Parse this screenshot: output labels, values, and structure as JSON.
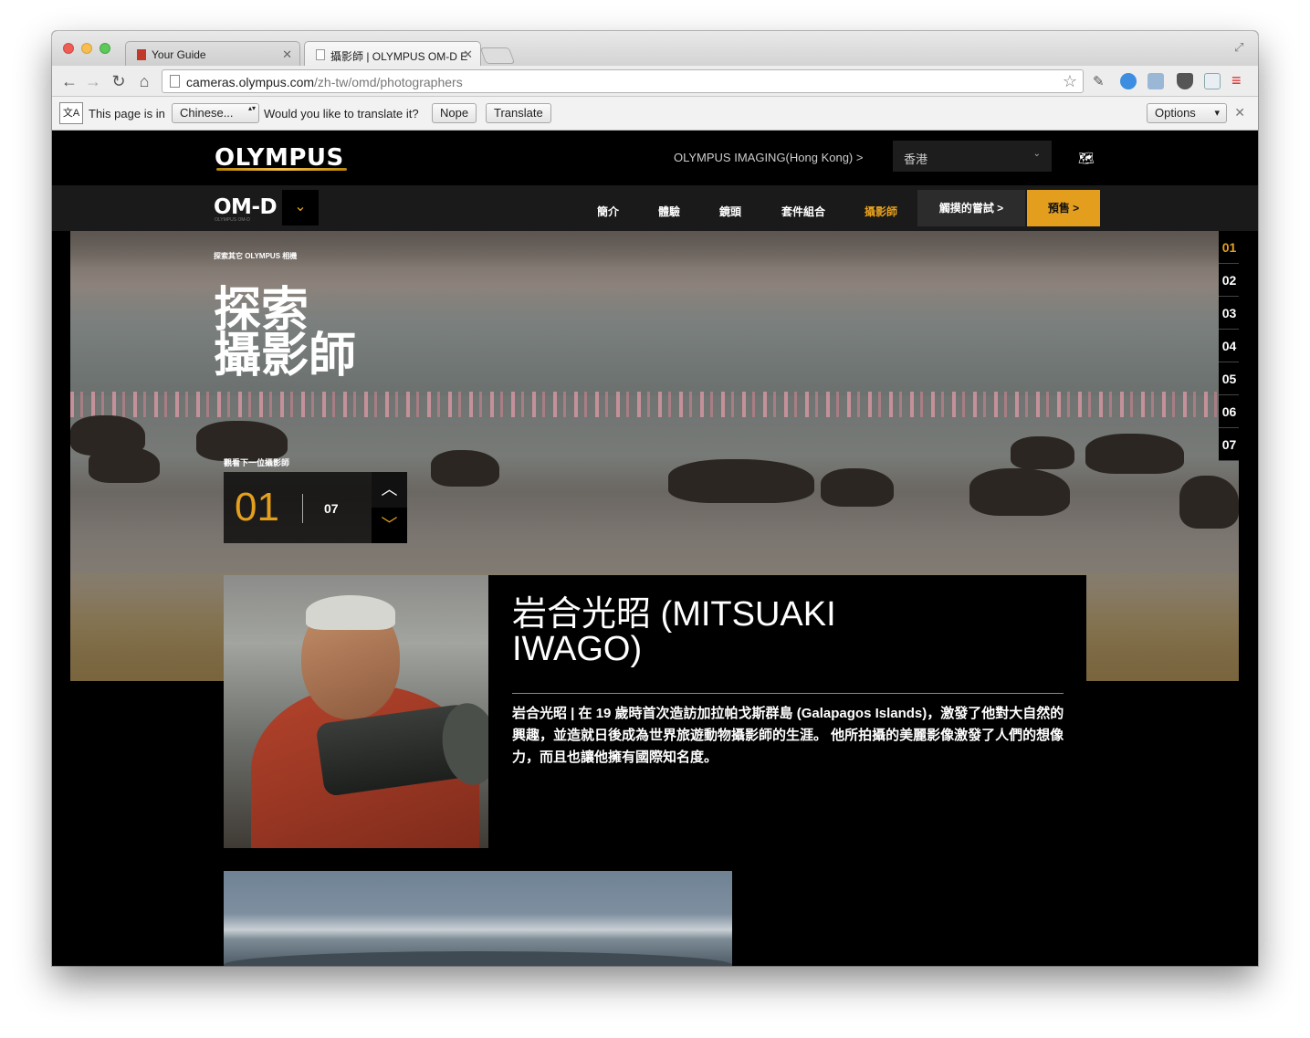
{
  "browser": {
    "tabs": [
      {
        "title": "Your Guide",
        "active": false
      },
      {
        "title": "攝影師 | OLYMPUS OM-D E",
        "active": true
      }
    ],
    "url_host": "cameras.olympus.com",
    "url_path": "/zh-tw/omd/photographers",
    "nav_icons": [
      "back-arrow-icon",
      "forward-arrow-icon",
      "reload-icon",
      "home-icon"
    ],
    "extension_icons": [
      "eyedropper-icon",
      "circle-extension-icon",
      "screenshot-icon",
      "pocket-icon",
      "ie-tab-icon",
      "menu-icon"
    ]
  },
  "translate_bar": {
    "prefix": "This page is in",
    "language": "Chinese...",
    "question": "Would you like to translate it?",
    "nope_label": "Nope",
    "translate_label": "Translate",
    "options_label": "Options"
  },
  "site": {
    "logo": "OLYMPUS",
    "region_link": "OLYMPUS IMAGING(Hong Kong) >",
    "region_select": "香港",
    "omd_logo": "OM-D",
    "omd_sub": "OLYMPUS OM-D",
    "nav": [
      {
        "label": "簡介",
        "active": false
      },
      {
        "label": "體驗",
        "active": false
      },
      {
        "label": "鏡頭",
        "active": false
      },
      {
        "label": "套件組合",
        "active": false
      },
      {
        "label": "攝影師",
        "active": true
      }
    ],
    "try_label": "觸摸的嘗試 >",
    "preorder_label": "預售 >",
    "accent_color": "#e49f1e"
  },
  "hero": {
    "breadcrumb": "探索其它 OLYMPUS 相機",
    "title_line1": "探索",
    "title_line2": "攝影師",
    "pager": [
      "01",
      "02",
      "03",
      "04",
      "05",
      "06",
      "07"
    ],
    "active_page": "01",
    "next_label": "觀看下一位攝影師",
    "counter_current": "01",
    "counter_total": "07"
  },
  "profile": {
    "name": "岩合光昭 (MITSUAKI IWAGO)",
    "bio": "岩合光昭 | 在 19 歲時首次造訪加拉帕戈斯群島 (Galapagos Islands)，激發了他對大自然的興趣，並造就日後成為世界旅遊動物攝影師的生涯。 他所拍攝的美麗影像激發了人們的想像力，而且也讓他擁有國際知名度。"
  }
}
